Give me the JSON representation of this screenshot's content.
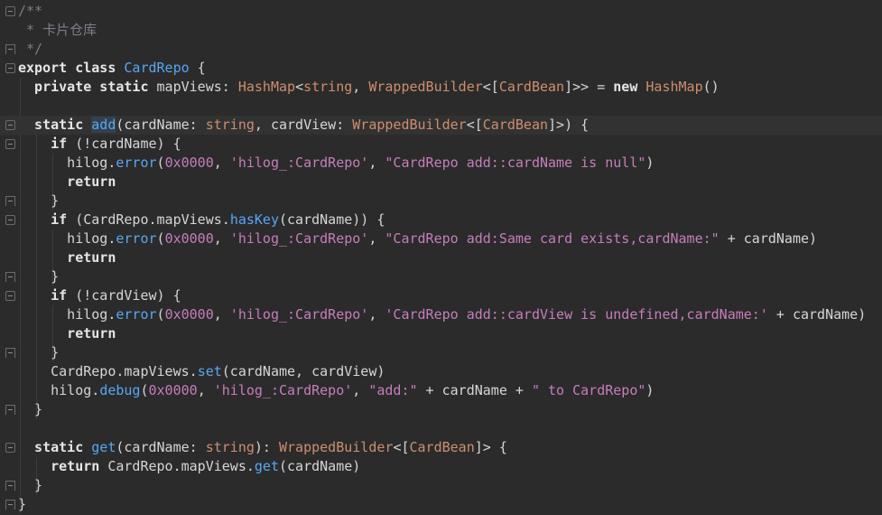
{
  "lines": [
    {
      "t": [
        {
          "c": "cm",
          "s": "/**"
        }
      ]
    },
    {
      "t": [
        {
          "c": "cm",
          "s": " * 卡片仓库"
        }
      ]
    },
    {
      "t": [
        {
          "c": "cm",
          "s": " */"
        }
      ]
    },
    {
      "t": [
        {
          "c": "kwb",
          "s": "export class "
        },
        {
          "c": "cls",
          "s": "CardRepo"
        },
        {
          "c": "tx",
          "s": " {"
        }
      ]
    },
    {
      "t": [
        {
          "c": "kwb",
          "s": "  private static "
        },
        {
          "c": "tx",
          "s": "mapViews: "
        },
        {
          "c": "ty",
          "s": "HashMap"
        },
        {
          "c": "tx",
          "s": "<"
        },
        {
          "c": "ty",
          "s": "string"
        },
        {
          "c": "tx",
          "s": ", "
        },
        {
          "c": "ty",
          "s": "WrappedBuilder"
        },
        {
          "c": "tx",
          "s": "<["
        },
        {
          "c": "ty",
          "s": "CardBean"
        },
        {
          "c": "tx",
          "s": "]>> = "
        },
        {
          "c": "kwb",
          "s": "new "
        },
        {
          "c": "ty",
          "s": "HashMap"
        },
        {
          "c": "tx",
          "s": "()"
        }
      ]
    },
    {
      "t": [
        {
          "c": "tx",
          "s": ""
        }
      ]
    },
    {
      "t": [
        {
          "c": "kwb",
          "s": "  static "
        },
        {
          "c": "fn",
          "s": "add"
        },
        {
          "c": "tx",
          "s": "(cardName: "
        },
        {
          "c": "ty",
          "s": "string"
        },
        {
          "c": "tx",
          "s": ", cardView: "
        },
        {
          "c": "ty",
          "s": "WrappedBuilder"
        },
        {
          "c": "tx",
          "s": "<["
        },
        {
          "c": "ty",
          "s": "CardBean"
        },
        {
          "c": "tx",
          "s": "]>) {"
        }
      ]
    },
    {
      "t": [
        {
          "c": "kwb",
          "s": "    if "
        },
        {
          "c": "tx",
          "s": "(!cardName) {"
        }
      ]
    },
    {
      "t": [
        {
          "c": "tx",
          "s": "      hilog."
        },
        {
          "c": "fn",
          "s": "error"
        },
        {
          "c": "tx",
          "s": "("
        },
        {
          "c": "num",
          "s": "0x0000"
        },
        {
          "c": "tx",
          "s": ", "
        },
        {
          "c": "st",
          "s": "'hilog_:CardRepo'"
        },
        {
          "c": "tx",
          "s": ", "
        },
        {
          "c": "st",
          "s": "\"CardRepo add::cardName is null\""
        },
        {
          "c": "tx",
          "s": ")"
        }
      ]
    },
    {
      "t": [
        {
          "c": "kwb",
          "s": "      return"
        }
      ]
    },
    {
      "t": [
        {
          "c": "tx",
          "s": "    }"
        }
      ]
    },
    {
      "t": [
        {
          "c": "kwb",
          "s": "    if "
        },
        {
          "c": "tx",
          "s": "(CardRepo.mapViews."
        },
        {
          "c": "fn",
          "s": "hasKey"
        },
        {
          "c": "tx",
          "s": "(cardName)) {"
        }
      ]
    },
    {
      "t": [
        {
          "c": "tx",
          "s": "      hilog."
        },
        {
          "c": "fn",
          "s": "error"
        },
        {
          "c": "tx",
          "s": "("
        },
        {
          "c": "num",
          "s": "0x0000"
        },
        {
          "c": "tx",
          "s": ", "
        },
        {
          "c": "st",
          "s": "'hilog_:CardRepo'"
        },
        {
          "c": "tx",
          "s": ", "
        },
        {
          "c": "st",
          "s": "\"CardRepo add:Same card exists,cardName:\""
        },
        {
          "c": "tx",
          "s": " + cardName)"
        }
      ]
    },
    {
      "t": [
        {
          "c": "kwb",
          "s": "      return"
        }
      ]
    },
    {
      "t": [
        {
          "c": "tx",
          "s": "    }"
        }
      ]
    },
    {
      "t": [
        {
          "c": "kwb",
          "s": "    if "
        },
        {
          "c": "tx",
          "s": "(!cardView) {"
        }
      ]
    },
    {
      "t": [
        {
          "c": "tx",
          "s": "      hilog."
        },
        {
          "c": "fn",
          "s": "error"
        },
        {
          "c": "tx",
          "s": "("
        },
        {
          "c": "num",
          "s": "0x0000"
        },
        {
          "c": "tx",
          "s": ", "
        },
        {
          "c": "st",
          "s": "'hilog_:CardRepo'"
        },
        {
          "c": "tx",
          "s": ", "
        },
        {
          "c": "st",
          "s": "'CardRepo add::cardView is undefined,cardName:'"
        },
        {
          "c": "tx",
          "s": " + cardName)"
        }
      ]
    },
    {
      "t": [
        {
          "c": "kwb",
          "s": "      return"
        }
      ]
    },
    {
      "t": [
        {
          "c": "tx",
          "s": "    }"
        }
      ]
    },
    {
      "t": [
        {
          "c": "tx",
          "s": "    CardRepo.mapViews."
        },
        {
          "c": "fn",
          "s": "set"
        },
        {
          "c": "tx",
          "s": "(cardName, cardView)"
        }
      ]
    },
    {
      "t": [
        {
          "c": "tx",
          "s": "    hilog."
        },
        {
          "c": "fn",
          "s": "debug"
        },
        {
          "c": "tx",
          "s": "("
        },
        {
          "c": "num",
          "s": "0x0000"
        },
        {
          "c": "tx",
          "s": ", "
        },
        {
          "c": "st",
          "s": "'hilog_:CardRepo'"
        },
        {
          "c": "tx",
          "s": ", "
        },
        {
          "c": "st",
          "s": "\"add:\""
        },
        {
          "c": "tx",
          "s": " + cardName + "
        },
        {
          "c": "st",
          "s": "\" to CardRepo\""
        },
        {
          "c": "tx",
          "s": ")"
        }
      ]
    },
    {
      "t": [
        {
          "c": "tx",
          "s": "  }"
        }
      ]
    },
    {
      "t": [
        {
          "c": "tx",
          "s": ""
        }
      ]
    },
    {
      "t": [
        {
          "c": "kwb",
          "s": "  static "
        },
        {
          "c": "fn",
          "s": "get"
        },
        {
          "c": "tx",
          "s": "(cardName: "
        },
        {
          "c": "ty",
          "s": "string"
        },
        {
          "c": "tx",
          "s": "): "
        },
        {
          "c": "ty",
          "s": "WrappedBuilder"
        },
        {
          "c": "tx",
          "s": "<["
        },
        {
          "c": "ty",
          "s": "CardBean"
        },
        {
          "c": "tx",
          "s": "]> {"
        }
      ]
    },
    {
      "t": [
        {
          "c": "kwb",
          "s": "    return "
        },
        {
          "c": "tx",
          "s": "CardRepo.mapViews."
        },
        {
          "c": "fn",
          "s": "get"
        },
        {
          "c": "tx",
          "s": "(cardName)"
        }
      ]
    },
    {
      "t": [
        {
          "c": "tx",
          "s": "  }"
        }
      ]
    },
    {
      "t": [
        {
          "c": "tx",
          "s": "}"
        }
      ]
    }
  ],
  "highlighted_line": 6,
  "colors": {
    "background": "#2b2b2b",
    "current_line": "#323232",
    "keyword": "#cf8e6d",
    "function": "#56a8f5",
    "string": "#c77dbb",
    "comment": "#7a7e85"
  }
}
